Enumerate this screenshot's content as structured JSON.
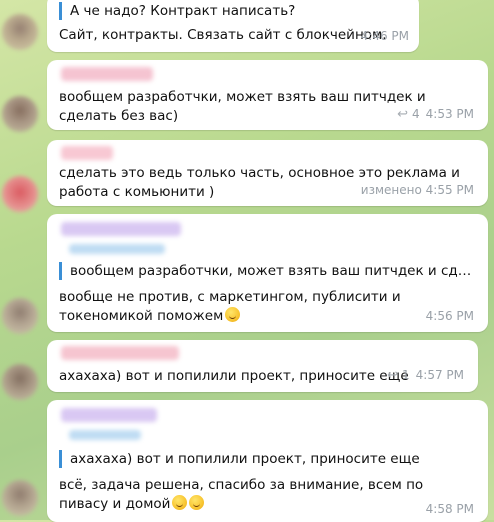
{
  "messages": [
    {
      "quote": "А че надо? Контракт написать?",
      "text": "Сайт, контракты. Связать сайт с блокчейном.",
      "time": "4:46 PM"
    },
    {
      "text": "вообщем разработчки, может взять ваш питчдек и сделать без вас)",
      "replies": "4",
      "time": "4:53 PM"
    },
    {
      "text": "сделать это ведь только часть, основное это реклама и работа с комьюнити )",
      "time": "изменено 4:55 PM"
    },
    {
      "quote": "вообщем разработчки, может взять ваш питчдек и сделать б…",
      "text": "вообще не против, с маркетингом, публисити и токеномикой поможем",
      "time": "4:56 PM"
    },
    {
      "text": "ахахаха) вот и попилили проект, приносите еще",
      "replies": "1",
      "time": "4:57 PM"
    },
    {
      "quote": "ахахаха) вот и попилили проект, приносите еще",
      "text": "всё, задача решена, спасибо за внимание, всем по пивасу и домой",
      "time": "4:58 PM"
    }
  ],
  "colors": {
    "quote_bar": "#3a8fd6",
    "meta": "#9aa1a8",
    "bubble": "#ffffff"
  },
  "icons": {
    "reply": "reply-arrow-icon",
    "emoji": "grinning-sweat-emoji-icon"
  }
}
